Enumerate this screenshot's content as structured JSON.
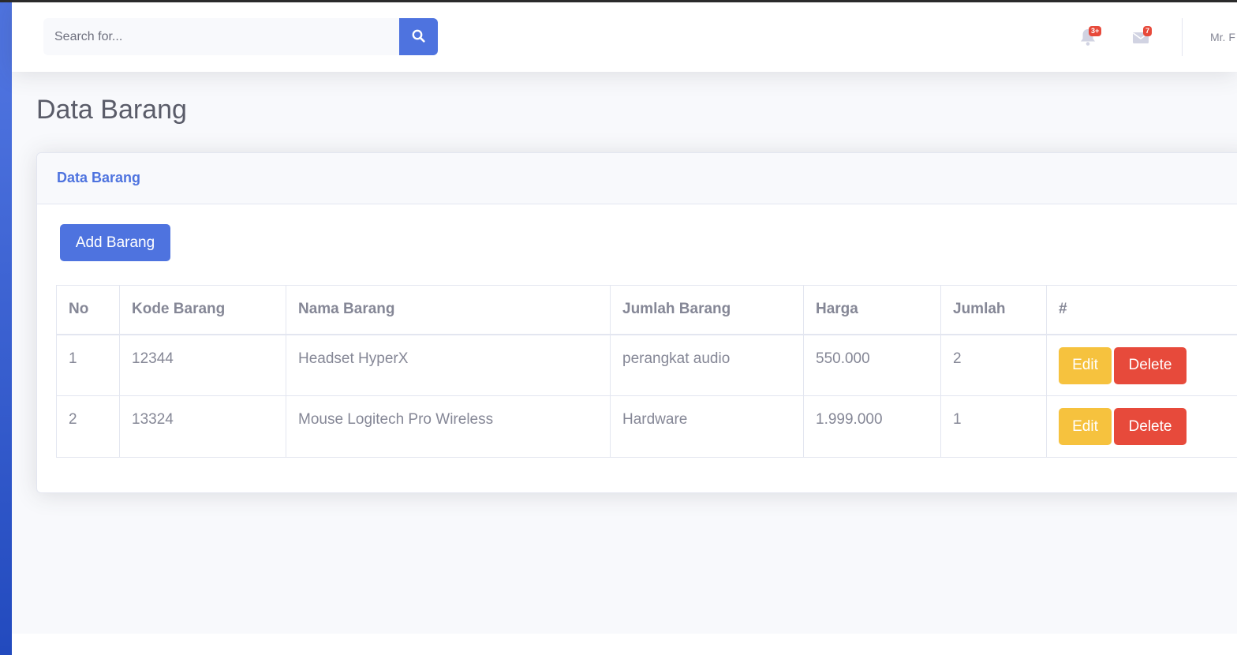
{
  "topbar": {
    "search": {
      "placeholder": "Search for...",
      "value": ""
    },
    "alerts_badge": "3+",
    "messages_badge": "7",
    "user_name": "Mr. F"
  },
  "page": {
    "title": "Data Barang"
  },
  "card": {
    "header_title": "Data Barang",
    "add_button_label": "Add Barang"
  },
  "table": {
    "headers": [
      "No",
      "Kode Barang",
      "Nama Barang",
      "Jumlah Barang",
      "Harga",
      "Jumlah",
      "#"
    ],
    "rows": [
      {
        "no": "1",
        "kode": "12344",
        "nama": "Headset HyperX",
        "jumlah_barang": "perangkat audio",
        "harga": "550.000",
        "jumlah": "2",
        "edit": "Edit",
        "delete": "Delete"
      },
      {
        "no": "2",
        "kode": "13324",
        "nama": "Mouse Logitech Pro Wireless",
        "jumlah_barang": "Hardware",
        "harga": "1.999.000",
        "jumlah": "1",
        "edit": "Edit",
        "delete": "Delete"
      }
    ]
  },
  "colors": {
    "primary": "#4e73df",
    "warning": "#f6c23e",
    "danger": "#e74a3b",
    "text_muted": "#858796"
  },
  "icons": [
    "search-icon",
    "bell-icon",
    "envelope-icon"
  ]
}
